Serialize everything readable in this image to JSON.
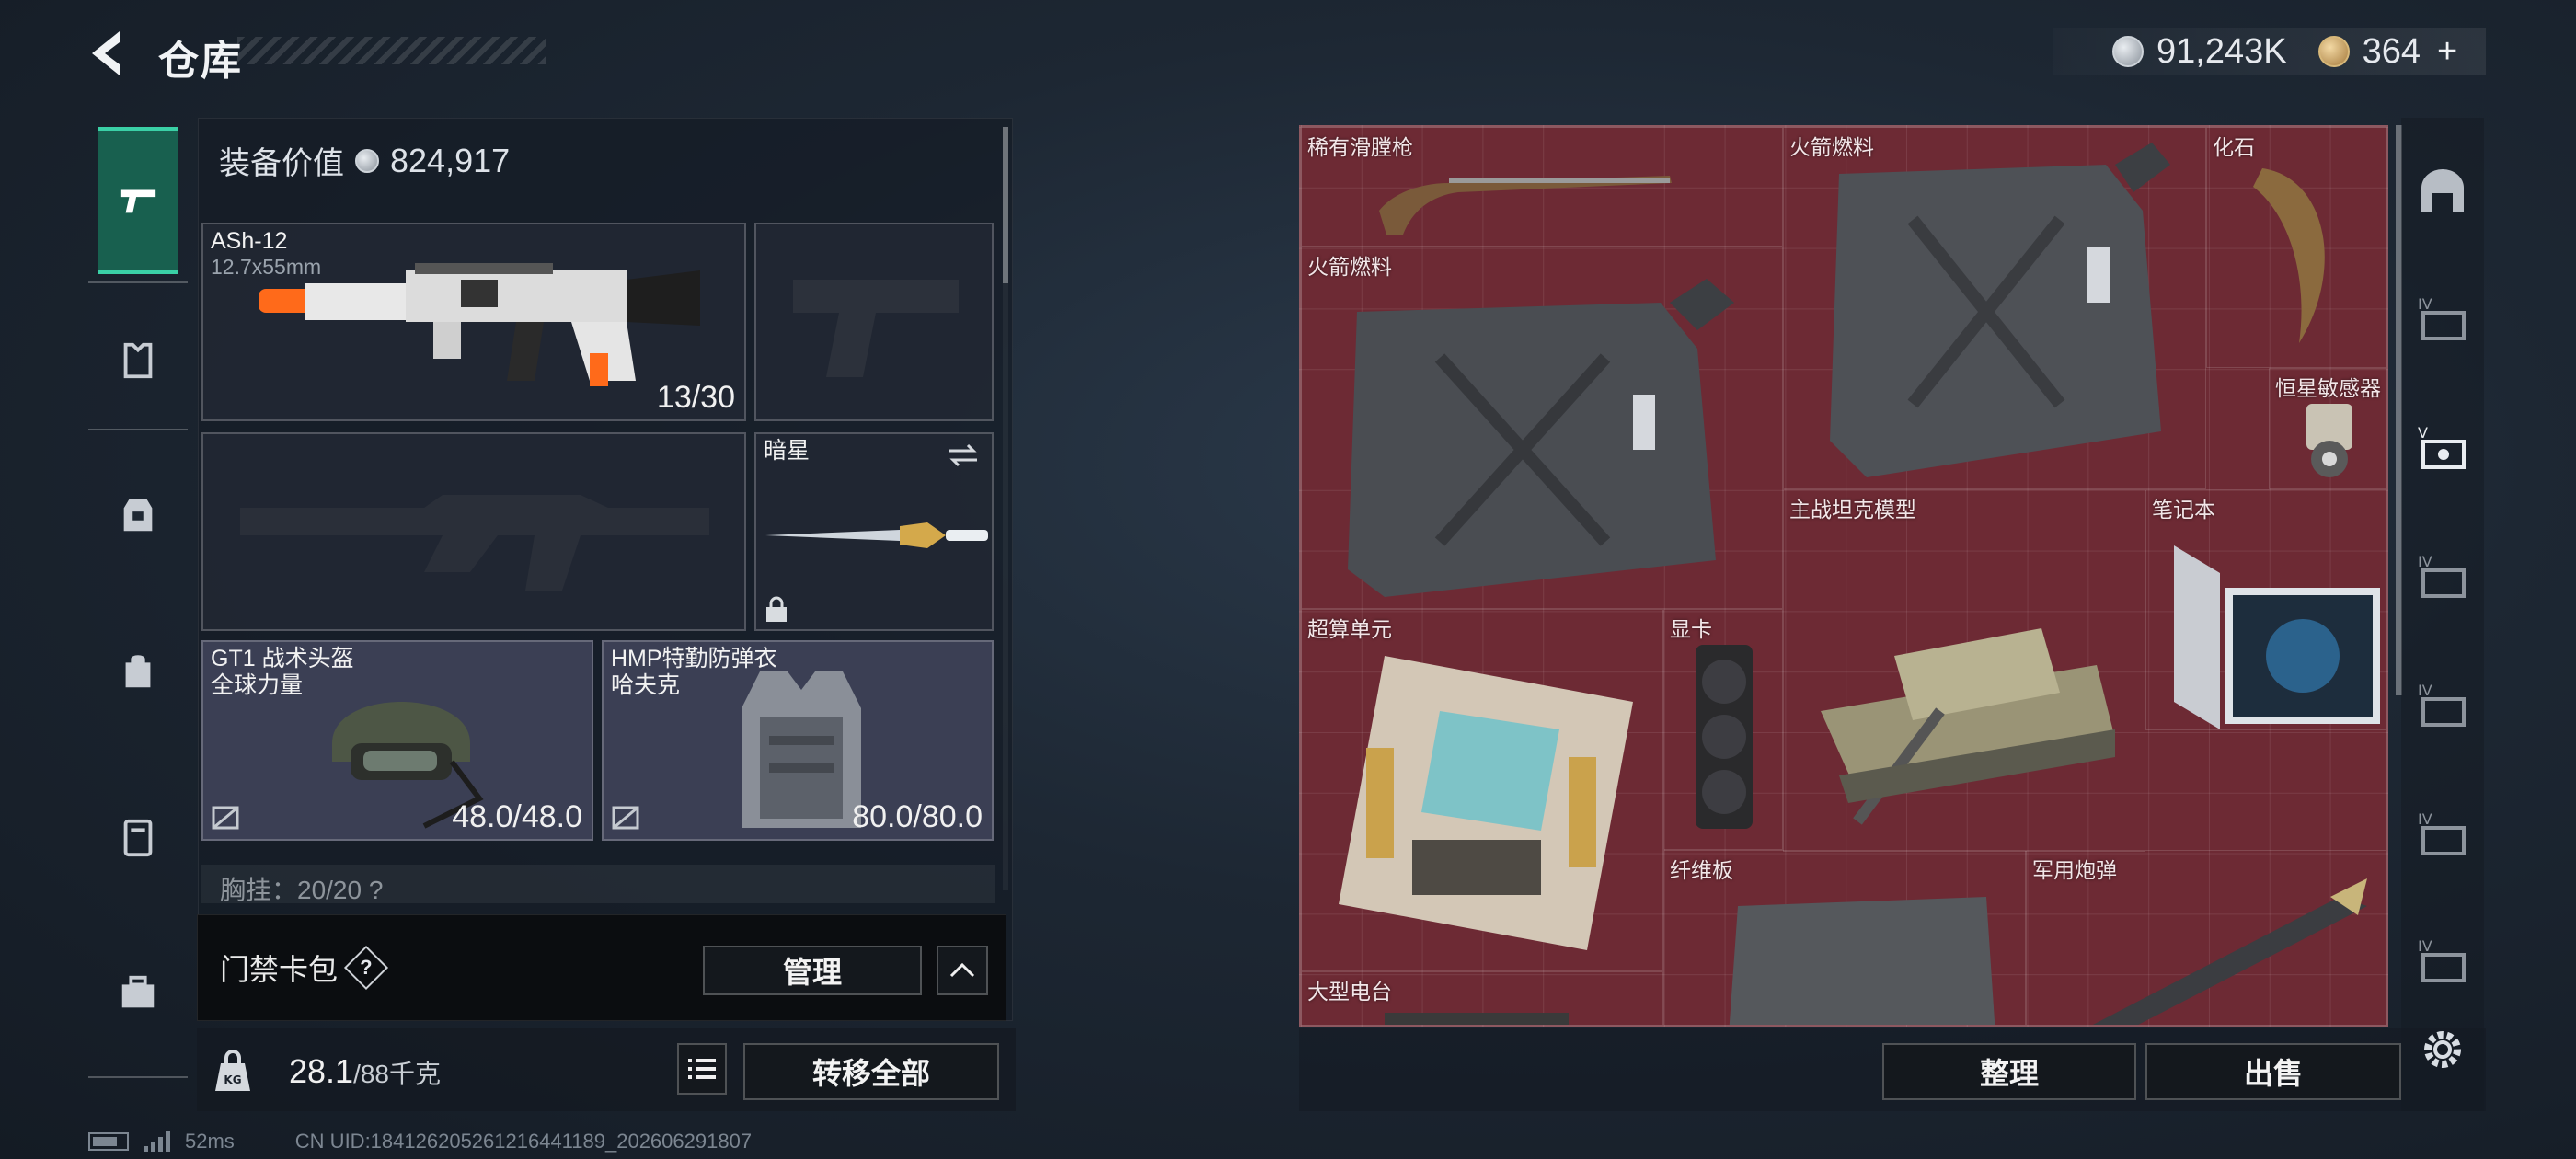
{
  "header": {
    "title": "仓库"
  },
  "currency": {
    "silver": "91,243K",
    "gold": "364",
    "plus": "+"
  },
  "nav": {
    "items": [
      "weapon-tab",
      "armor-tab",
      "vest-tab",
      "backpack-tab",
      "locker-tab",
      "toolbox-tab"
    ]
  },
  "equipment": {
    "value_label": "装备价值",
    "value": "824,917",
    "primary": {
      "name": "ASh-12",
      "caliber": "12.7x55mm",
      "ammo": "13/30"
    },
    "melee": {
      "name": "暗星"
    },
    "helmet": {
      "name": "GT1 战术头盔",
      "brand": "全球力量",
      "durability": "48.0/48.0"
    },
    "armor": {
      "name": "HMP特勤防弹衣",
      "brand": "哈夫克",
      "durability": "80.0/80.0"
    },
    "chest": "胸挂：20/20 ?"
  },
  "keycard": {
    "label": "门禁卡包",
    "help": "?",
    "manage": "管理"
  },
  "bag": {
    "weight": "28.1",
    "max": "/88千克",
    "transfer": "转移全部"
  },
  "status": {
    "ping": "52ms",
    "uid": "CN UID:18412620526121644118​9_202606291807"
  },
  "storage": {
    "items": [
      {
        "key": "flintlock",
        "name": "稀有滑膛枪"
      },
      {
        "key": "fuel1",
        "name": "火箭燃料"
      },
      {
        "key": "fossil",
        "name": "化石"
      },
      {
        "key": "fuel2",
        "name": "火箭燃料"
      },
      {
        "key": "sensor",
        "name": "恒星敏感器"
      },
      {
        "key": "tank",
        "name": "主战坦克模型"
      },
      {
        "key": "laptop",
        "name": "笔记本"
      },
      {
        "key": "supercomputer",
        "name": "超算单元"
      },
      {
        "key": "gpu",
        "name": "显卡"
      },
      {
        "key": "fiber",
        "name": "纤维板"
      },
      {
        "key": "shell",
        "name": "军用炮弹"
      },
      {
        "key": "radio",
        "name": "大型电台"
      }
    ],
    "sort": "整理",
    "sell": "出售"
  },
  "right_tabs": [
    "warehouse-home",
    "IV",
    "V",
    "IV",
    "IV",
    "IV",
    "IV"
  ],
  "colors": {
    "accent": "#3ad0a6",
    "storage_bg": "#6d2a34",
    "gear_slot": "#3b3f54"
  }
}
